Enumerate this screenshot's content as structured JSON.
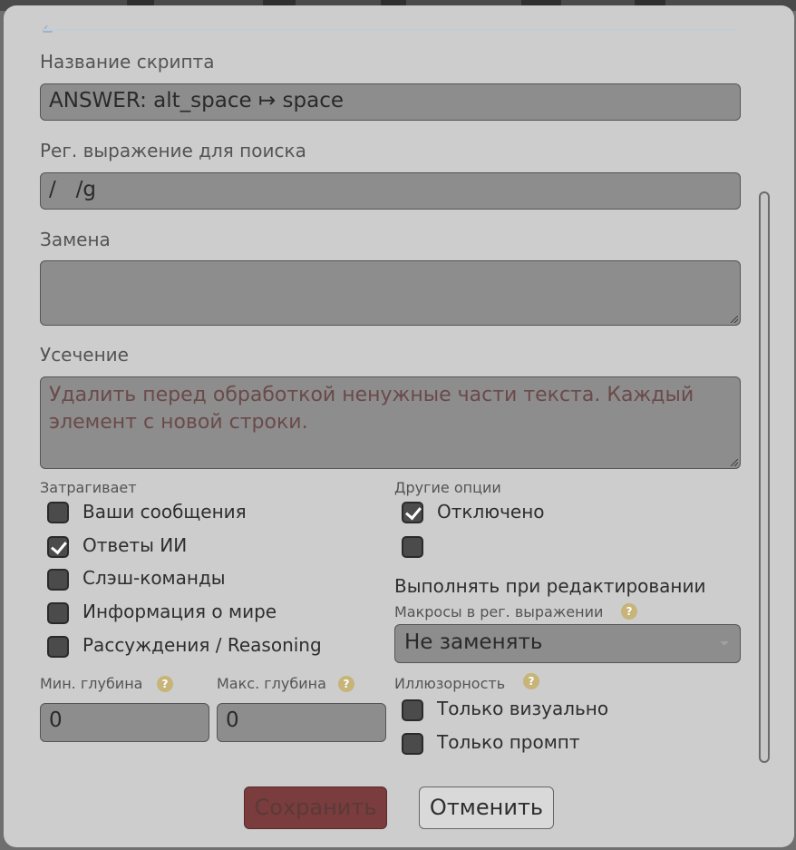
{
  "form": {
    "script_name_label": "Название скрипта",
    "script_name_value": "ANSWER: alt_space ↦ space",
    "regex_label": "Рег. выражение для поиска",
    "regex_value": "/   /g",
    "replace_label": "Замена",
    "replace_value": "",
    "trim_label": "Усечение",
    "trim_placeholder": "Удалить перед обработкой ненужные части текста. Каждый элемент с новой строки."
  },
  "affects": {
    "title": "Затрагивает",
    "items": [
      {
        "label": "Ваши сообщения",
        "checked": false
      },
      {
        "label": "Ответы ИИ",
        "checked": true
      },
      {
        "label": "Слэш-команды",
        "checked": false
      },
      {
        "label": "Информация о мире",
        "checked": false
      },
      {
        "label": "Рассуждения / Reasoning",
        "checked": false
      }
    ]
  },
  "other": {
    "title": "Другие опции",
    "disabled_label": "Отключено",
    "disabled_checked": true,
    "run_on_edit_label": "Выполнять при редактировании",
    "run_on_edit_checked": false
  },
  "macros": {
    "label": "Макросы в рег. выражении",
    "selected": "Не заменять"
  },
  "depth": {
    "min_label": "Мин. глубина",
    "min_value": "0",
    "max_label": "Макс. глубина",
    "max_value": "0"
  },
  "ephemerality": {
    "label": "Иллюзорность",
    "items": [
      {
        "label": "Только визуально",
        "checked": false
      },
      {
        "label": "Только промпт",
        "checked": false
      }
    ]
  },
  "help_glyph": "?",
  "buttons": {
    "save": "Сохранить",
    "cancel": "Отменить"
  },
  "colors": {
    "dialog_bg": "#cdcdcd",
    "field_bg": "#8d8d8d",
    "save_bg": "#7a3c3c",
    "help_badge": "#c7b478"
  }
}
